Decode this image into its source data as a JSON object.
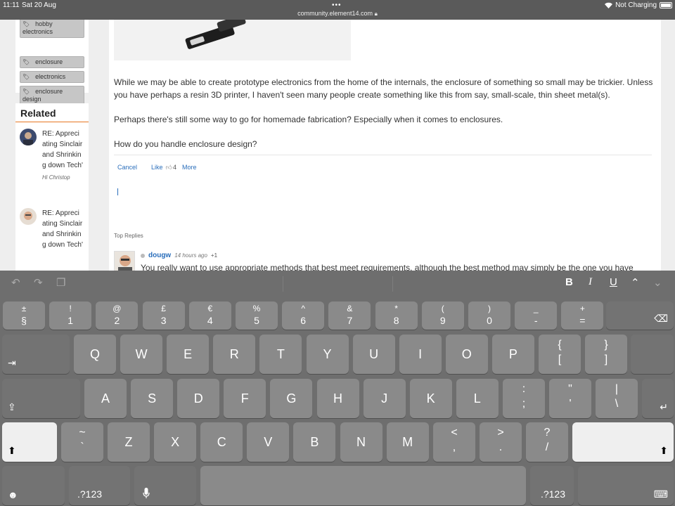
{
  "status": {
    "time": "11:11",
    "date": "Sat 20 Aug",
    "url": "community.element14.com",
    "charging": "Not Charging"
  },
  "sidebar": {
    "tags": [
      "hobby electronics",
      "enclosure",
      "electronics",
      "enclosure design"
    ],
    "related_title": "Related",
    "related": [
      {
        "text": "RE: Appreciating Sinclair and Shrinking down Tech'",
        "by": "Hi Christop"
      },
      {
        "text": "RE: Appreciating Sinclair and Shrinking down Tech'",
        "by": ""
      }
    ]
  },
  "post": {
    "para1": "While we may be able to create prototype electronics from the home of the internals, the enclosure of something so small may be trickier. Unless you have perhaps a resin 3D printer, I haven't seen many people create something like this from say, small-scale, thin sheet metal(s).",
    "para2": "Perhaps there's still some way to go for homemade fabrication? Especially when it comes to enclosures.",
    "para3": "How do you handle enclosure design?",
    "actions": {
      "cancel": "Cancel",
      "like": "Like",
      "like_count": "4",
      "more": "More"
    }
  },
  "replies": {
    "label": "Top Replies",
    "first": {
      "user": "dougw",
      "ago": "14 hours ago",
      "score": "+1",
      "body": "You really want to use appropriate methods that best meet requirements, although the best method may simply be the one you have"
    }
  },
  "keyboard": {
    "toolbar": {
      "bold": "B",
      "italic": "I",
      "underline": "U",
      "up": "⌃",
      "down": "⌄"
    },
    "number_row": [
      {
        "top": "±",
        "bot": "§"
      },
      {
        "top": "!",
        "bot": "1"
      },
      {
        "top": "@",
        "bot": "2"
      },
      {
        "top": "£",
        "bot": "3"
      },
      {
        "top": "€",
        "bot": "4"
      },
      {
        "top": "%",
        "bot": "5"
      },
      {
        "top": "^",
        "bot": "6"
      },
      {
        "top": "&",
        "bot": "7"
      },
      {
        "top": "*",
        "bot": "8"
      },
      {
        "top": "(",
        "bot": "9"
      },
      {
        "top": ")",
        "bot": "0"
      },
      {
        "top": "_",
        "bot": "-"
      },
      {
        "top": "+",
        "bot": "="
      }
    ],
    "row_q": [
      "Q",
      "W",
      "E",
      "R",
      "T",
      "Y",
      "U",
      "I",
      "O",
      "P"
    ],
    "row_q_pairs": [
      {
        "top": "{",
        "bot": "["
      },
      {
        "top": "}",
        "bot": "]"
      }
    ],
    "row_a": [
      "A",
      "S",
      "D",
      "F",
      "G",
      "H",
      "J",
      "K",
      "L"
    ],
    "row_a_pairs": [
      {
        "top": ":",
        "bot": ";"
      },
      {
        "top": "\"",
        "bot": "'"
      },
      {
        "top": "|",
        "bot": "\\"
      }
    ],
    "row_z_pre": {
      "top": "~",
      "bot": "`"
    },
    "row_z": [
      "Z",
      "X",
      "C",
      "V",
      "B",
      "N",
      "M"
    ],
    "row_z_pairs": [
      {
        "top": "<",
        "bot": ","
      },
      {
        "top": ">",
        "bot": "."
      },
      {
        "top": "?",
        "bot": "/"
      }
    ],
    "numbers_label": ".?123"
  }
}
